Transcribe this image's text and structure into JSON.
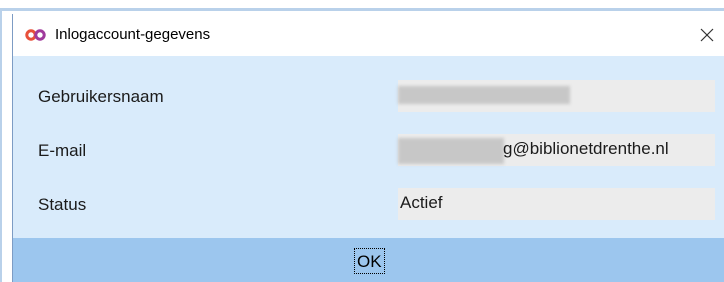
{
  "window": {
    "title": "Inlogaccount-gegevens",
    "icon": "infinity-logo-icon",
    "close_icon": "close-icon"
  },
  "fields": [
    {
      "label": "Gebruikersnaam",
      "value": ""
    },
    {
      "label": "E-mail",
      "value": "g@biblionetdrenthe.nl"
    },
    {
      "label": "Status",
      "value": "Actief"
    }
  ],
  "buttons": {
    "ok_label": "OK"
  },
  "colors": {
    "dialog_background": "#d9ebfb",
    "button_bar": "#9cc6ee",
    "field_background": "#ececec",
    "logo_left": "#e8503a",
    "logo_right": "#a03a9c"
  }
}
